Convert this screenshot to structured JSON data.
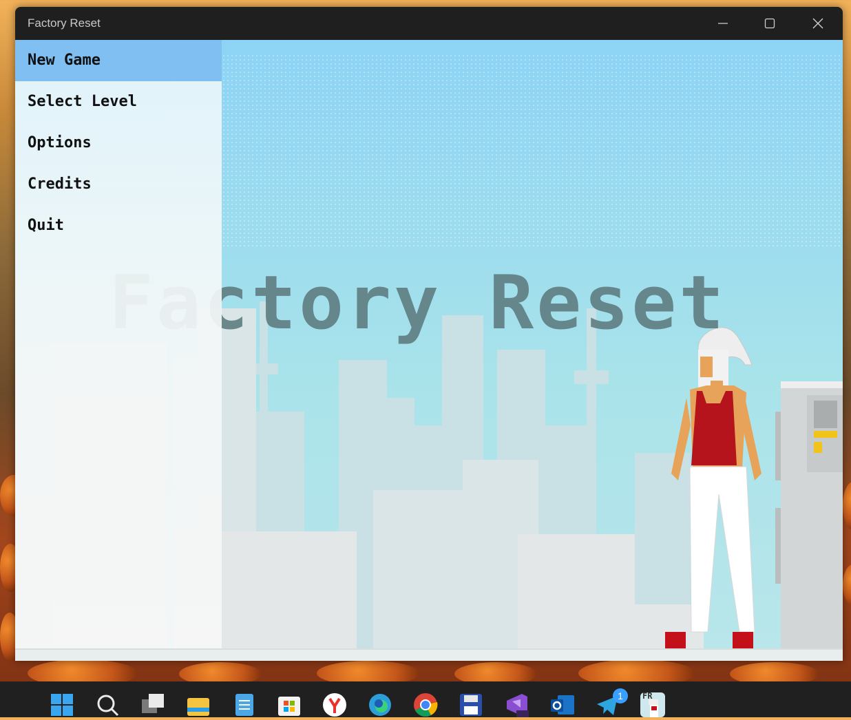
{
  "window": {
    "title": "Factory Reset"
  },
  "menu": {
    "items": [
      {
        "label": "New Game",
        "active": true
      },
      {
        "label": "Select Level",
        "active": false
      },
      {
        "label": "Options",
        "active": false
      },
      {
        "label": "Credits",
        "active": false
      },
      {
        "label": "Quit",
        "active": false
      }
    ]
  },
  "game": {
    "title": "Factory Reset"
  },
  "taskbar": {
    "apps": [
      {
        "name": "start-icon"
      },
      {
        "name": "search-icon"
      },
      {
        "name": "task-view-icon"
      },
      {
        "name": "file-explorer-icon"
      },
      {
        "name": "notepad-icon"
      },
      {
        "name": "store-icon"
      },
      {
        "name": "yandex-browser-icon"
      },
      {
        "name": "edge-icon"
      },
      {
        "name": "chrome-icon"
      },
      {
        "name": "save-disk-icon"
      },
      {
        "name": "visual-studio-preview-icon"
      },
      {
        "name": "outlook-icon"
      },
      {
        "name": "telegram-icon"
      },
      {
        "name": "factory-reset-app-icon"
      }
    ],
    "telegram_badge": "1",
    "fr_icon_label": "FR"
  },
  "colors": {
    "menu_active": "#7fbff2",
    "title_text": "#5f7d80",
    "titlebar": "#1f1f1f"
  }
}
